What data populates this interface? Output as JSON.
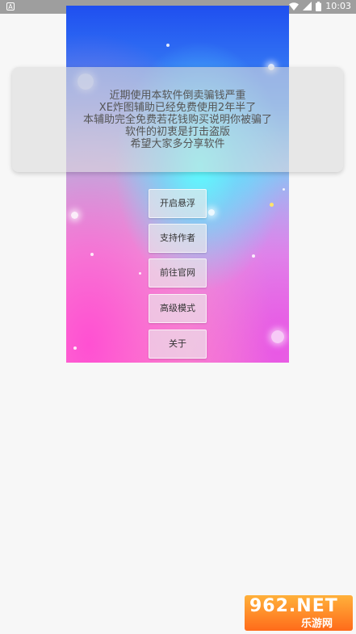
{
  "status_bar": {
    "app_icon_letter": "A",
    "time": "10:03",
    "icons": [
      "wifi-icon",
      "signal-icon",
      "battery-icon"
    ]
  },
  "notice": {
    "lines": [
      "近期使用本软件倒卖骗钱严重",
      "XE炸图辅助已经免费使用2年半了",
      "本辅助完全免费若花钱购买说明你被骗了",
      "软件的初衷是打击盗版",
      "希望大家多分享软件"
    ]
  },
  "menu": {
    "buttons": [
      "开启悬浮",
      "支持作者",
      "前往官网",
      "高级模式",
      "关于"
    ]
  },
  "watermark": {
    "top": "962.NET",
    "bottom": "乐游网"
  },
  "colors": {
    "status_bar": "#9e9e9e",
    "page_background": "#f7f7f7",
    "watermark": "#ff8a2a"
  }
}
